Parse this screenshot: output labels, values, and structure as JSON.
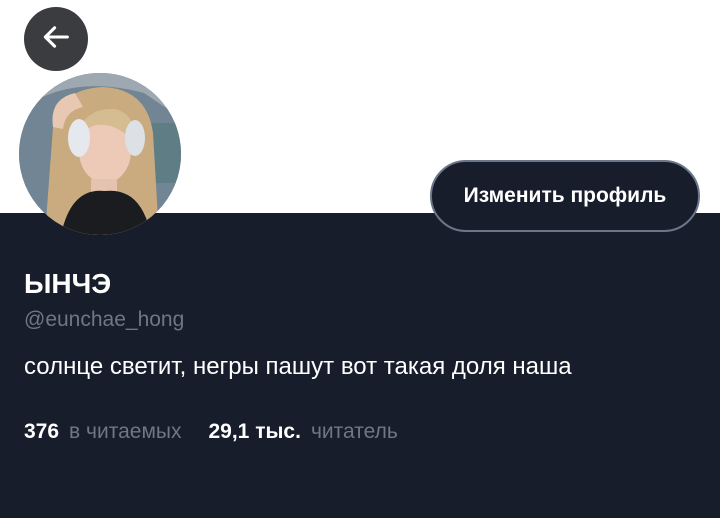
{
  "header": {
    "back_icon": "arrow-left-icon"
  },
  "profile": {
    "display_name": "ЫНЧЭ",
    "handle": "@eunchae_hong",
    "bio": "солнце светит, негры пашут вот такая доля наша",
    "edit_button_label": "Изменить профиль"
  },
  "stats": {
    "following": {
      "count": "376",
      "label": "в читаемых"
    },
    "followers": {
      "count": "29,1 тыс.",
      "label": "читатель"
    }
  },
  "colors": {
    "panel_background": "#171d2b",
    "secondary_text": "#6e7785",
    "back_button": "#3b3c40",
    "button_border": "#6b7688"
  }
}
